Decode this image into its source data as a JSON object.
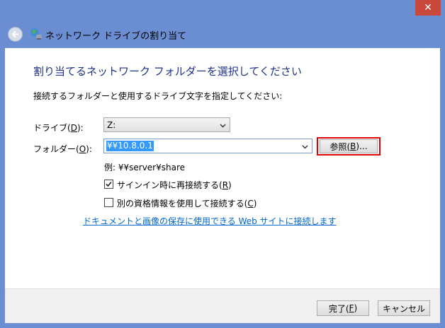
{
  "window": {
    "title": "ネットワーク ドライブの割り当て",
    "close_glyph": "✕"
  },
  "dialog": {
    "heading": "割り当てるネットワーク フォルダーを選択してください",
    "instruction": "接続するフォルダーと使用するドライブ文字を指定してください:",
    "drive": {
      "label_pre": "ドライブ(",
      "label_key": "D",
      "label_post": "):",
      "value": "Z:"
    },
    "folder": {
      "label_pre": "フォルダー(",
      "label_key": "O",
      "label_post": "):",
      "value": "¥¥10.8.0.1"
    },
    "browse": {
      "label_pre": "参照(",
      "label_key": "B",
      "label_post": ")..."
    },
    "example": "例: ¥¥server¥share",
    "reconnect": {
      "label_pre": "サインイン時に再接続する(",
      "label_key": "R",
      "label_post": ")",
      "checked": true
    },
    "credentials": {
      "label_pre": "別の資格情報を使用して接続する(",
      "label_key": "C",
      "label_post": ")",
      "checked": false
    },
    "link": "ドキュメントと画像の保存に使用できる Web サイトに接続します"
  },
  "footer": {
    "finish": {
      "label_pre": "完了(",
      "label_key": "F",
      "label_post": ")"
    },
    "cancel": "キャンセル"
  },
  "colors": {
    "frame": "#6b8dd1",
    "heading": "#1e3287",
    "link": "#0066cc",
    "highlight": "#e00000",
    "selection": "#3399ff"
  }
}
